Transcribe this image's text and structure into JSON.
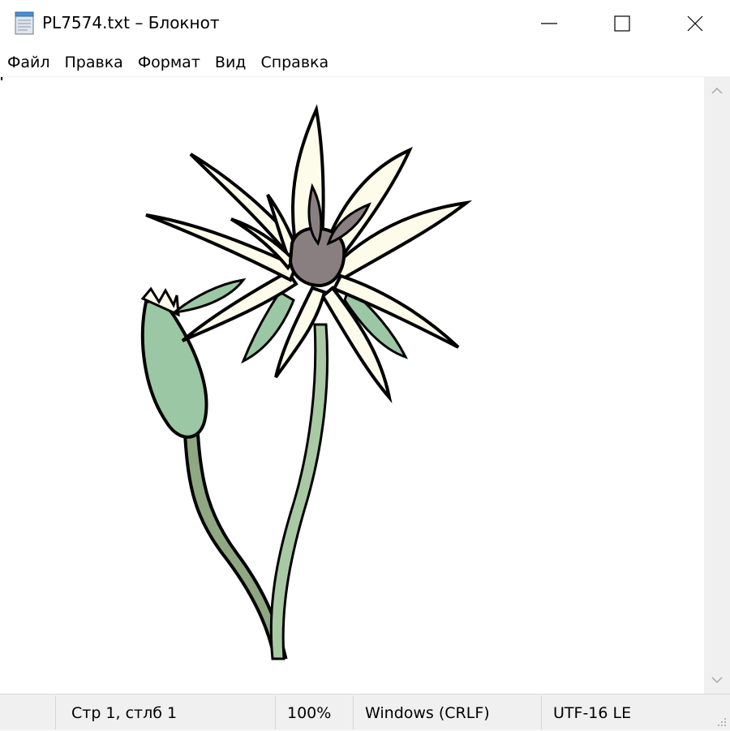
{
  "window": {
    "title": "PL7574.txt – Блокнот",
    "accent": "#000000"
  },
  "menu": {
    "items": [
      "Файл",
      "Правка",
      "Формат",
      "Вид",
      "Справка"
    ]
  },
  "icons": {
    "app": "notepad-icon",
    "minimize": "minimize-icon",
    "maximize": "maximize-icon",
    "close": "close-icon",
    "scroll_up": "chevron-up-icon",
    "scroll_down": "chevron-down-icon",
    "illustration": "flower-illustration"
  },
  "statusbar": {
    "position": "Стр 1, стлб 1",
    "zoom": "100%",
    "line_ending": "Windows (CRLF)",
    "encoding": "UTF-16 LE"
  },
  "colors": {
    "petal": "#fdfcea",
    "stem": "#a9c9a4",
    "leaf": "#9cc7a4",
    "center": "#8a7f80",
    "statusbar_bg": "#f0f0f0"
  }
}
